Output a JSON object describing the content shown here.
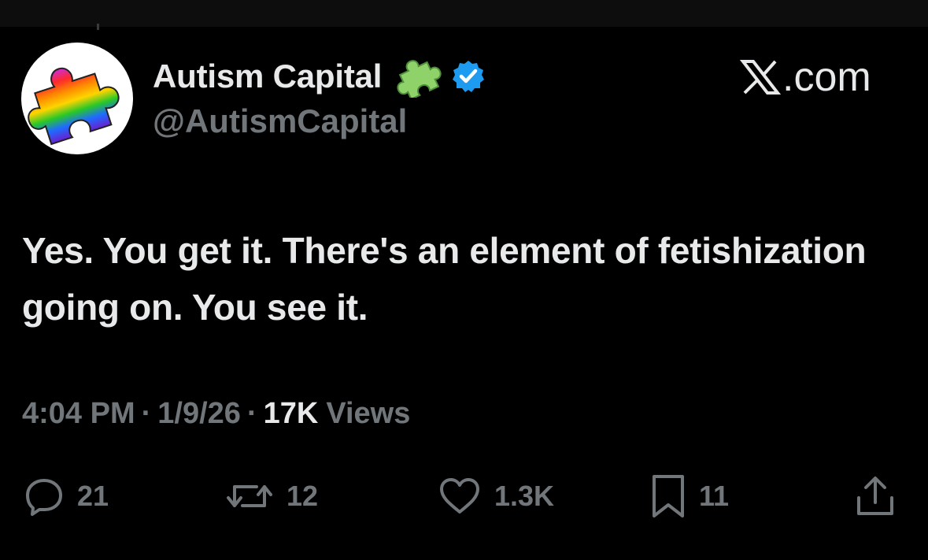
{
  "account": {
    "display_name": "Autism Capital",
    "handle": "@AutismCapital",
    "name_emoji": "puzzle-piece-emoji",
    "verified_icon": "verified-badge-icon",
    "verified_color": "#1d9bf0"
  },
  "source": {
    "logo": "x-logo-icon",
    "label": ".com"
  },
  "tweet": {
    "text": "Yes. You get it. There's an element of fetishization going on. You see it.",
    "time": "4:04 PM",
    "separator": "·",
    "date": "1/9/26",
    "views_count": "17K",
    "views_label": "Views"
  },
  "actions": {
    "replies": {
      "icon": "reply-icon",
      "count": "21"
    },
    "reposts": {
      "icon": "repost-icon",
      "count": "12"
    },
    "likes": {
      "icon": "heart-icon",
      "count": "1.3K"
    },
    "bookmarks": {
      "icon": "bookmark-icon",
      "count": "11"
    },
    "share": {
      "icon": "share-icon"
    }
  },
  "colors": {
    "background": "#000000",
    "primary_text": "#e7e9ea",
    "secondary_text": "#71767b"
  }
}
